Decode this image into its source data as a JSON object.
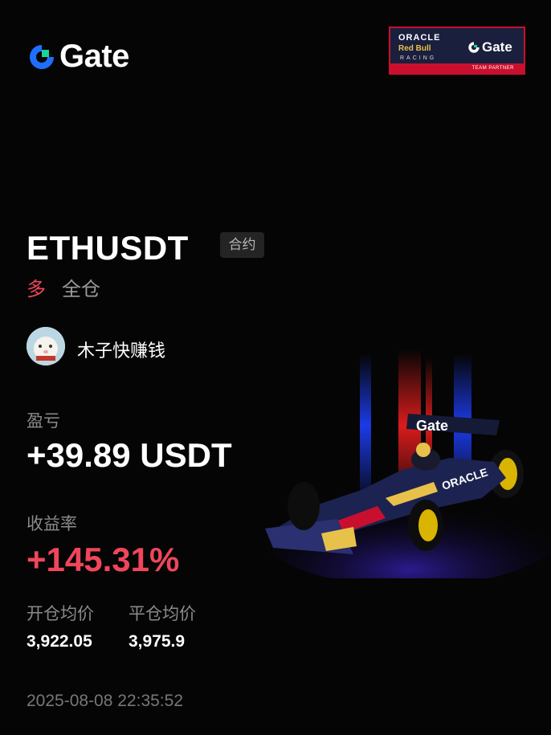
{
  "brand": {
    "name": "Gate",
    "accent": "#1f6fff",
    "accent2": "#19d39a"
  },
  "partner": {
    "line1": "ORACLE",
    "line2": "Red Bull",
    "line3": "RACING",
    "gate": "Gate",
    "tag": "TEAM PARTNER"
  },
  "position": {
    "pair": "ETHUSDT",
    "type_badge": "合约",
    "direction": "多",
    "margin_mode": "全仓"
  },
  "user": {
    "name": "木子快赚钱"
  },
  "pnl": {
    "label": "盈亏",
    "value": "+39.89 USDT"
  },
  "roi": {
    "label": "收益率",
    "value": "+145.31%"
  },
  "entry": {
    "label": "开仓均价",
    "value": "3,922.05"
  },
  "exit": {
    "label": "平仓均价",
    "value": "3,975.9"
  },
  "timestamp": "2025-08-08 22:35:52",
  "car_banner": "Gate",
  "car_sponsor": "ORACLE",
  "colors": {
    "profit": "#f0465a",
    "muted": "#8a8a8a",
    "background": "#050505"
  }
}
